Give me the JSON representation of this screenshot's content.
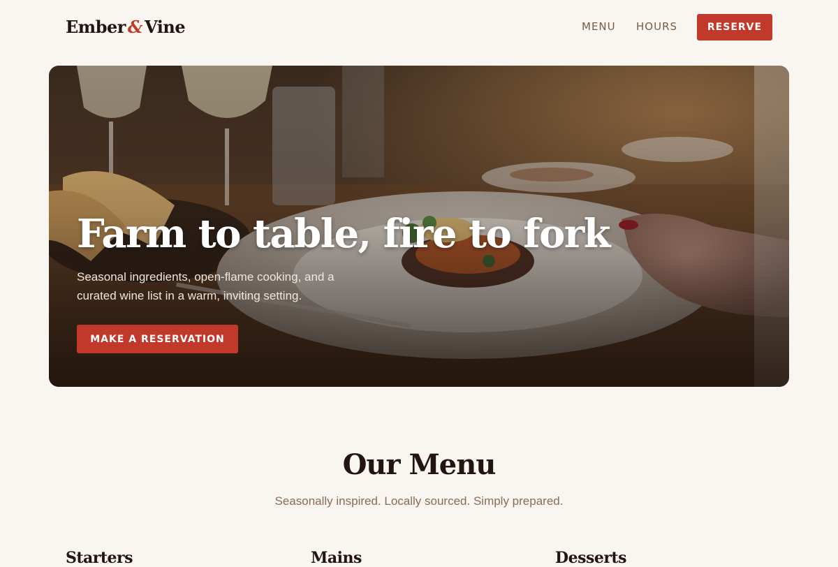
{
  "header": {
    "logo_part1": "Ember",
    "logo_amp": "&",
    "logo_part2": "Vine",
    "nav_menu": "MENU",
    "nav_hours": "HOURS",
    "reserve_label": "RESERVE"
  },
  "hero": {
    "title": "Farm to table, fire to fork",
    "subtitle": "Seasonal ingredients, open-flame cooking, and a curated wine list in a warm, inviting setting.",
    "cta_label": "MAKE A RESERVATION"
  },
  "menu_section": {
    "title": "Our Menu",
    "subtitle": "Seasonally inspired. Locally sourced. Simply prepared.",
    "categories": [
      "Starters",
      "Mains",
      "Desserts"
    ]
  },
  "colors": {
    "accent": "#c0392b",
    "background": "#f9f5f0",
    "text_dark": "#22140f",
    "text_muted": "#8a6c57"
  }
}
